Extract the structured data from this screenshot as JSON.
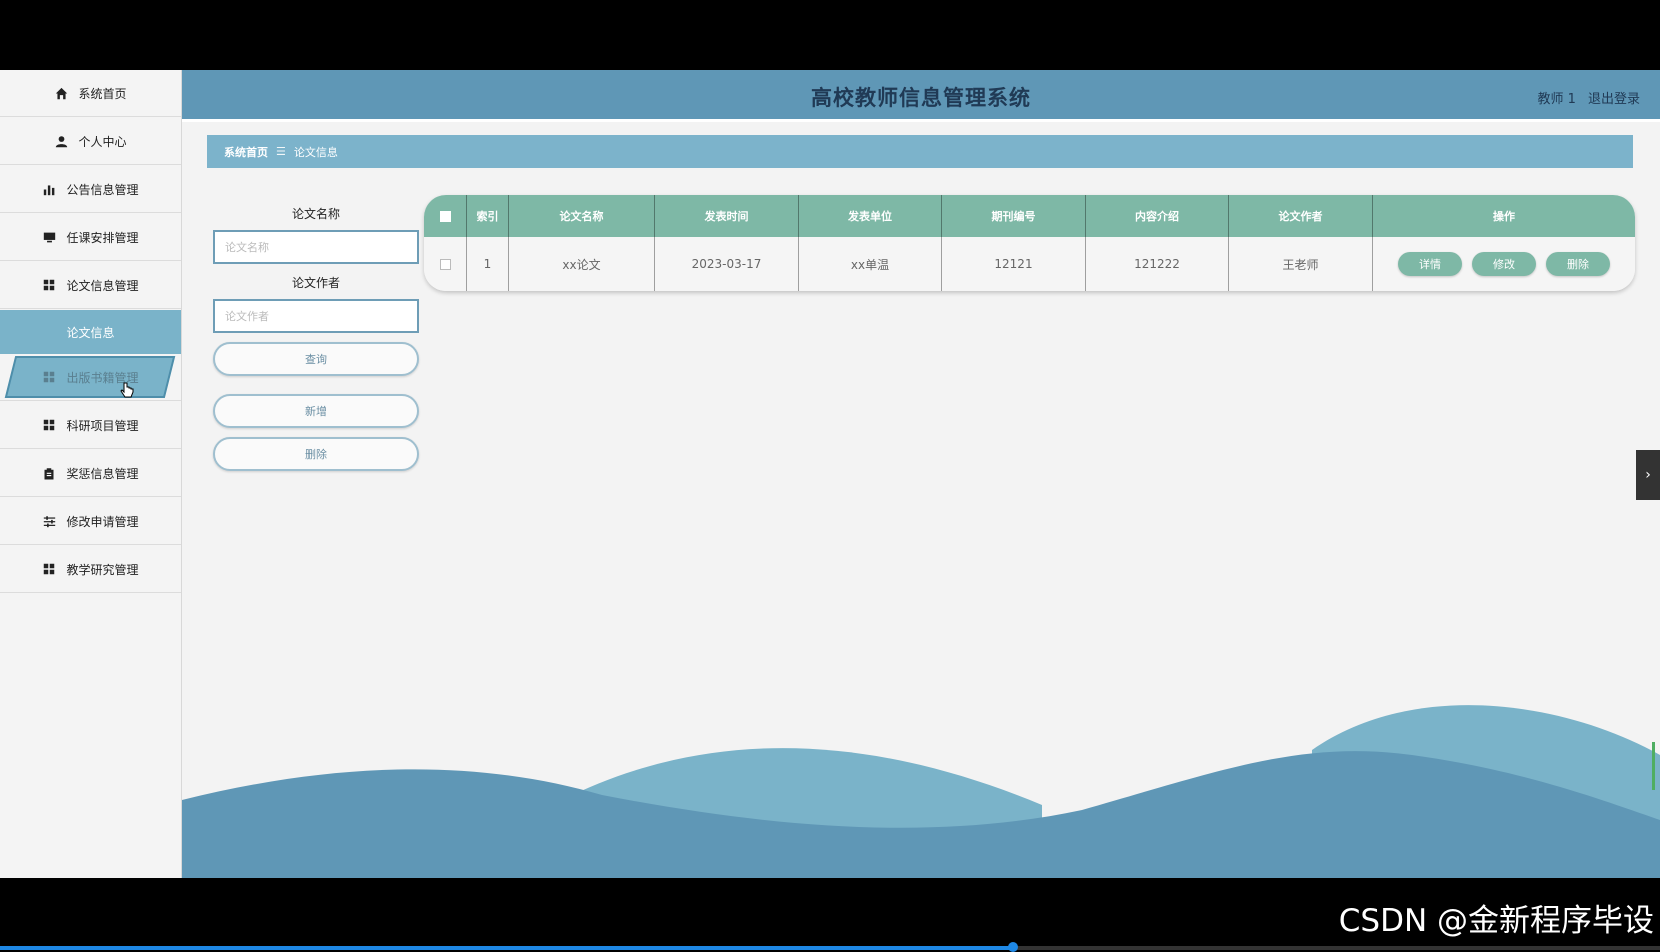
{
  "header": {
    "title": "高校教师信息管理系统",
    "user": "教师 1",
    "logout": "退出登录"
  },
  "sidebar": {
    "items": [
      {
        "label": "系统首页",
        "icon": "home-icon"
      },
      {
        "label": "个人中心",
        "icon": "user-icon"
      },
      {
        "label": "公告信息管理",
        "icon": "bar-chart-icon"
      },
      {
        "label": "任课安排管理",
        "icon": "monitor-icon"
      },
      {
        "label": "论文信息管理",
        "icon": "grid-icon"
      },
      {
        "label": "论文信息",
        "icon": ""
      },
      {
        "label": "出版书籍管理",
        "icon": "grid-icon"
      },
      {
        "label": "科研项目管理",
        "icon": "grid-icon"
      },
      {
        "label": "奖惩信息管理",
        "icon": "clipboard-icon"
      },
      {
        "label": "修改申请管理",
        "icon": "sliders-icon"
      },
      {
        "label": "教学研究管理",
        "icon": "grid-icon"
      }
    ]
  },
  "breadcrumb": {
    "home": "系统首页",
    "separator": "☰",
    "current": "论文信息"
  },
  "search": {
    "name_label": "论文名称",
    "name_placeholder": "论文名称",
    "author_label": "论文作者",
    "author_placeholder": "论文作者",
    "query_btn": "查询",
    "add_btn": "新增",
    "delete_btn": "删除"
  },
  "table": {
    "headers": [
      "索引",
      "论文名称",
      "发表时间",
      "发表单位",
      "期刊编号",
      "内容介绍",
      "论文作者",
      "操作"
    ],
    "rows": [
      {
        "index": "1",
        "name": "xx论文",
        "date": "2023-03-17",
        "unit": "xx单温",
        "journal": "12121",
        "intro": "121222",
        "author": "王老师"
      }
    ],
    "actions": {
      "detail": "详情",
      "edit": "修改",
      "delete": "删除"
    }
  },
  "drawer_handle": "›",
  "watermark": "CSDN @金新程序毕设",
  "video_progress": 0.61,
  "colors": {
    "header": "#5f97b6",
    "accent": "#7ab3c9",
    "table_header": "#7eb8a6",
    "wave_dark": "#5f97b6",
    "wave_light": "#7ab3c9"
  }
}
